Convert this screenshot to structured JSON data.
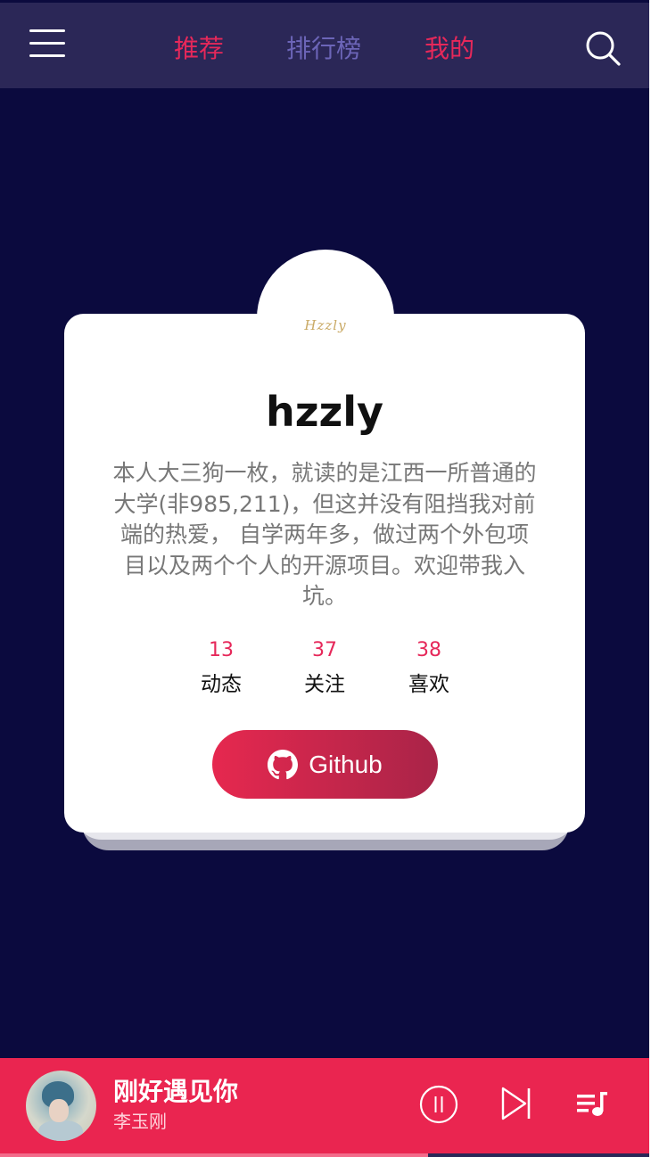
{
  "header": {
    "tabs": [
      {
        "label": "推荐",
        "active": false,
        "color": "#e6285a"
      },
      {
        "label": "排行榜",
        "active": false,
        "color": "#6c65b8"
      },
      {
        "label": "我的",
        "active": true,
        "color": "#e6285a"
      }
    ],
    "menu_icon": "hamburger-menu-icon",
    "search_icon": "search-icon"
  },
  "profile": {
    "avatar_logo": "Hzzly",
    "username": "hzzly",
    "bio": "本人大三狗一枚，就读的是江西一所普通的大学(非985,211)，但这并没有阻挡我对前端的热爱， 自学两年多，做过两个外包项目以及两个个人的开源项目。欢迎带我入坑。",
    "stats": [
      {
        "value": "13",
        "label": "动态"
      },
      {
        "value": "37",
        "label": "关注"
      },
      {
        "value": "38",
        "label": "喜欢"
      }
    ],
    "github_button": {
      "label": "Github",
      "icon": "github-icon"
    }
  },
  "player": {
    "song_title": "刚好遇见你",
    "artist": "李玉刚",
    "cover_icon": "album-cover",
    "controls": [
      "pause-icon",
      "next-track-icon",
      "playlist-icon"
    ],
    "progress_fraction": 0.66
  },
  "colors": {
    "background": "#0b0a3e",
    "header": "#2b2757",
    "accent": "#e6285a",
    "player_bar": "#ea2550"
  }
}
